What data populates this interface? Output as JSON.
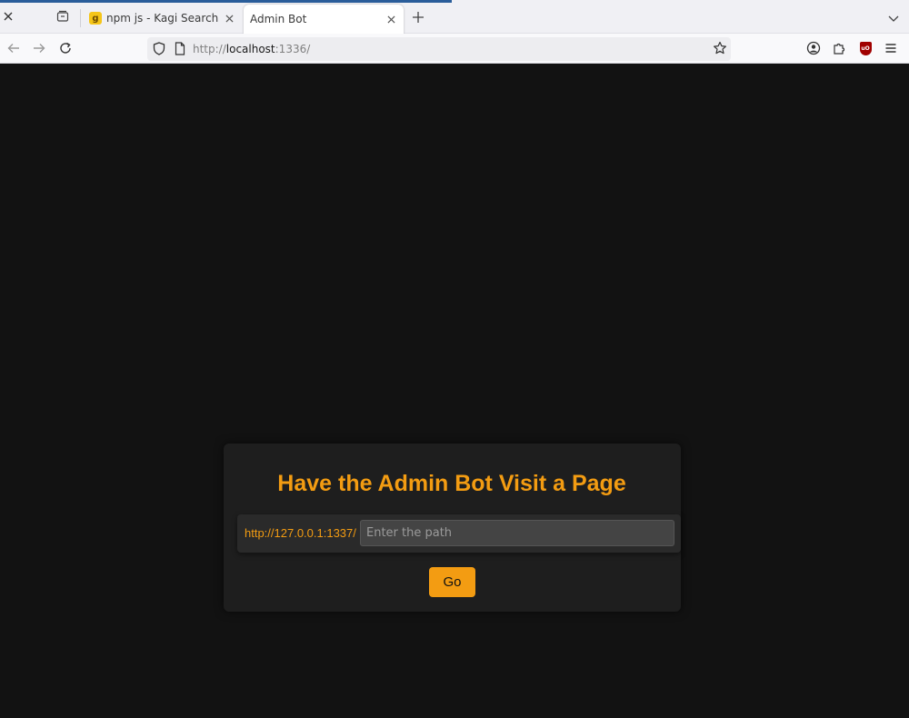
{
  "browser": {
    "tabs": [
      {
        "title": "npm js - Kagi Search",
        "favicon": "kagi-g",
        "active": false
      },
      {
        "title": "Admin Bot",
        "active": true
      }
    ],
    "url": {
      "scheme": "http://",
      "host": "localhost",
      "rest": ":1336/"
    }
  },
  "page": {
    "title": "Have the Admin Bot Visit a Page",
    "url_prefix": "http://127.0.0.1:1337/",
    "input_placeholder": "Enter the path",
    "input_value": "",
    "go_label": "Go"
  },
  "colors": {
    "accent": "#f39c12",
    "background": "#121212",
    "card": "#1e1e1e"
  }
}
